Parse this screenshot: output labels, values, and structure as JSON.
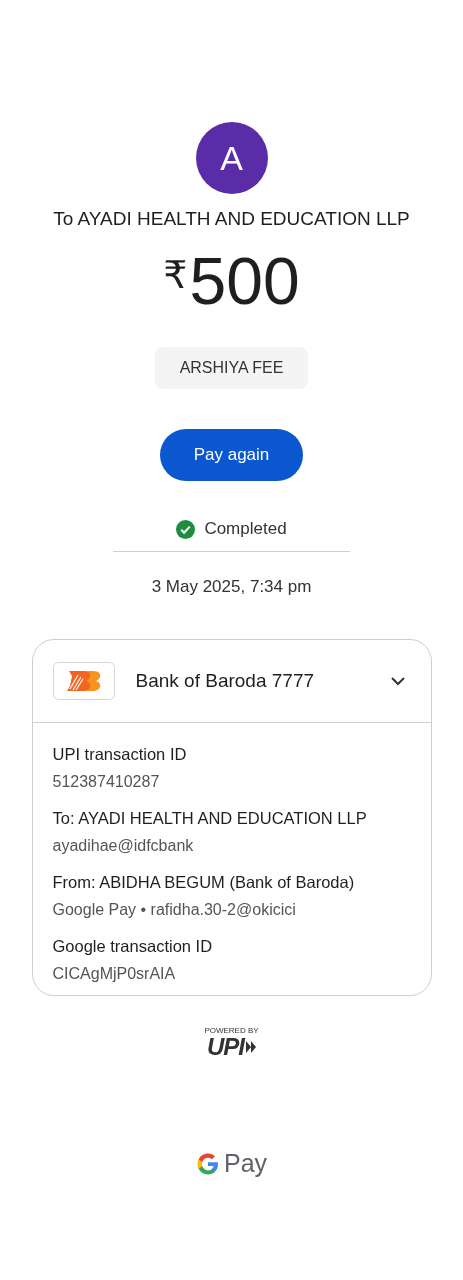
{
  "avatar": {
    "initial": "A"
  },
  "recipient_title": "To AYADI HEALTH AND EDUCATION LLP",
  "amount": {
    "currency": "₹",
    "value": "500"
  },
  "note": "ARSHIYA FEE",
  "action_button": "Pay again",
  "status": {
    "kind": "completed",
    "label": "Completed"
  },
  "date_time": "3 May 2025, 7:34 pm",
  "details_card": {
    "account": "Bank of Baroda 7777",
    "expanded": true,
    "fields": [
      {
        "label": "UPI transaction ID",
        "value": "512387410287"
      },
      {
        "label": "To: AYADI HEALTH AND EDUCATION LLP",
        "value": "ayadihae@idfcbank"
      },
      {
        "label": "From: ABIDHA BEGUM (Bank of Baroda)",
        "value": "Google Pay • rafidha.30-2@okicici"
      },
      {
        "label": "Google transaction ID",
        "value": "CICAgMjP0srAIA"
      }
    ]
  },
  "footer": {
    "powered_by": "POWERED BY",
    "upi": "UPI",
    "brand": "Pay"
  }
}
